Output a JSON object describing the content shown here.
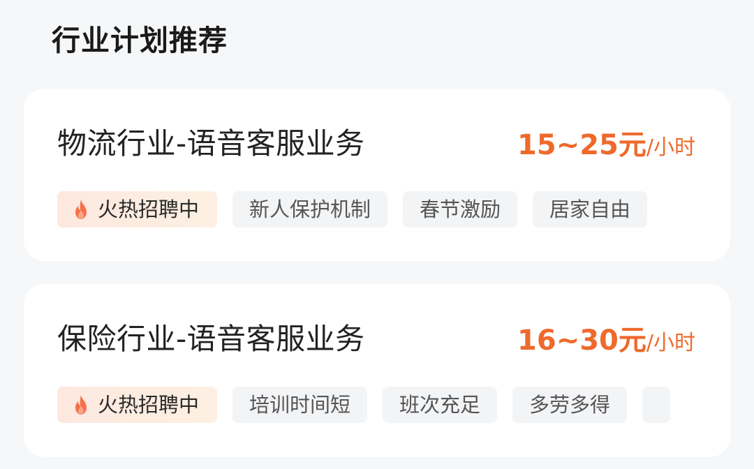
{
  "section": {
    "title": "行业计划推荐"
  },
  "cards": [
    {
      "title": "物流行业-语音客服业务",
      "wage": "15~25元",
      "wage_unit": "/小时",
      "hot_tag": "火热招聘中",
      "tags": [
        "新人保护机制",
        "春节激励",
        "居家自由"
      ]
    },
    {
      "title": "保险行业-语音客服业务",
      "wage": "16~30元",
      "wage_unit": "/小时",
      "hot_tag": "火热招聘中",
      "tags": [
        "培训时间短",
        "班次充足",
        "多劳多得"
      ]
    }
  ],
  "colors": {
    "accent": "#ee6a2c",
    "flame": "#f4724a",
    "background": "#f6f7f9",
    "card": "#ffffff",
    "tag_background": "#f3f4f6"
  },
  "icons": {
    "hot": "flame-icon"
  }
}
